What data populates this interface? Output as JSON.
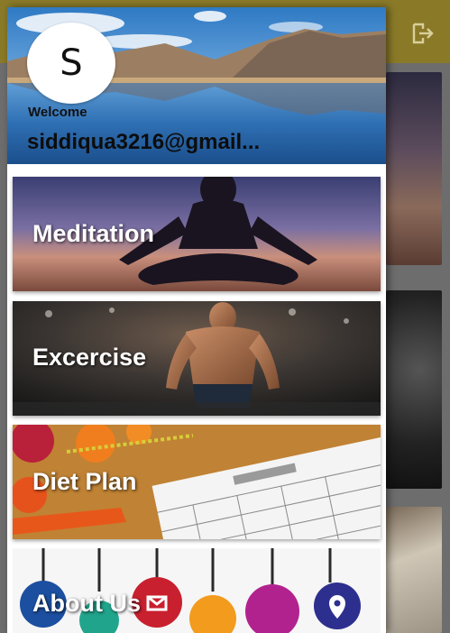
{
  "header": {
    "avatar_letter": "S",
    "welcome": "Welcome",
    "email": "siddiqua3216@gmail..."
  },
  "menu": {
    "items": [
      {
        "label": "Meditation"
      },
      {
        "label": "Excercise"
      },
      {
        "label": "Diet Plan"
      },
      {
        "label": "About Us"
      }
    ]
  },
  "colors": {
    "app_bar": "#8a7a28",
    "menu_text": "#ffffff",
    "drawer_bg": "#ffffff"
  },
  "icons": {
    "logout": "logout-icon"
  }
}
